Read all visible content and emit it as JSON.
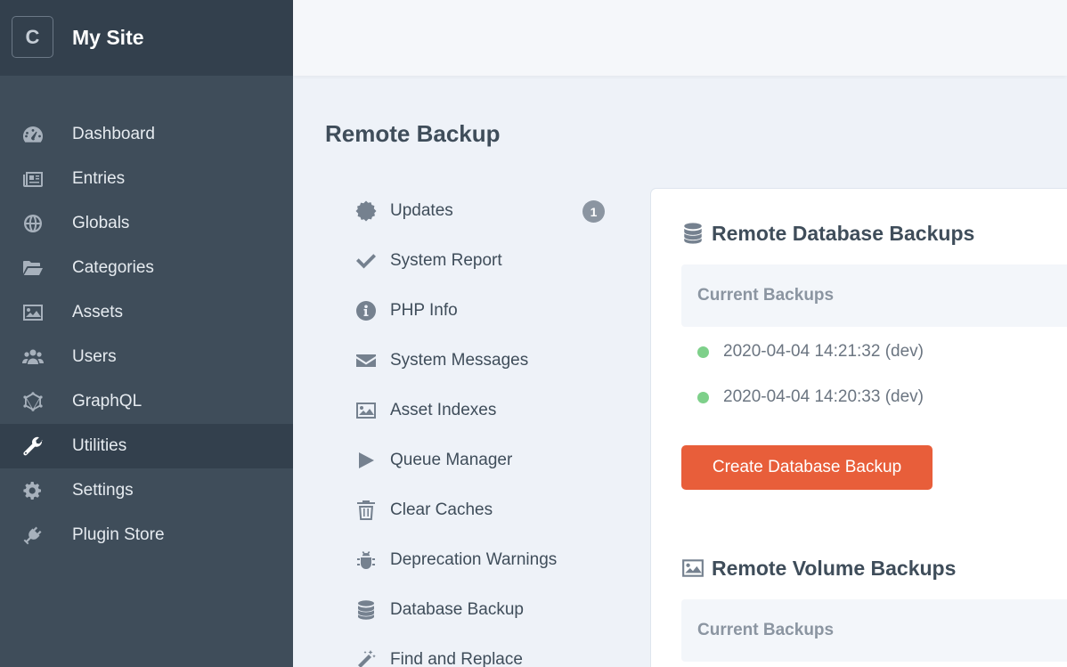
{
  "site": {
    "logo_letter": "C",
    "name": "My Site"
  },
  "sidebar": {
    "items": [
      {
        "label": "Dashboard",
        "icon": "dashboard-gauge-icon"
      },
      {
        "label": "Entries",
        "icon": "newspaper-icon"
      },
      {
        "label": "Globals",
        "icon": "globe-icon"
      },
      {
        "label": "Categories",
        "icon": "folder-open-icon"
      },
      {
        "label": "Assets",
        "icon": "image-icon"
      },
      {
        "label": "Users",
        "icon": "users-icon"
      },
      {
        "label": "GraphQL",
        "icon": "graphql-icon"
      },
      {
        "label": "Utilities",
        "icon": "wrench-icon",
        "active": true
      },
      {
        "label": "Settings",
        "icon": "gear-icon"
      },
      {
        "label": "Plugin Store",
        "icon": "plug-icon"
      }
    ]
  },
  "page": {
    "title": "Remote Backup"
  },
  "utilities": {
    "items": [
      {
        "label": "Updates",
        "icon": "badge-gear-icon",
        "badge": "1"
      },
      {
        "label": "System Report",
        "icon": "checkmark-icon"
      },
      {
        "label": "PHP Info",
        "icon": "info-circle-icon"
      },
      {
        "label": "System Messages",
        "icon": "envelope-icon"
      },
      {
        "label": "Asset Indexes",
        "icon": "image-icon"
      },
      {
        "label": "Queue Manager",
        "icon": "play-icon"
      },
      {
        "label": "Clear Caches",
        "icon": "trash-icon"
      },
      {
        "label": "Deprecation Warnings",
        "icon": "bug-icon"
      },
      {
        "label": "Database Backup",
        "icon": "database-icon"
      },
      {
        "label": "Find and Replace",
        "icon": "magic-wand-icon"
      }
    ]
  },
  "db_backups": {
    "title": "Remote Database Backups",
    "table_header": "Current Backups",
    "rows": [
      "2020-04-04 14:21:32 (dev)",
      "2020-04-04 14:20:33 (dev)"
    ],
    "status_color": "#7ed08a",
    "button_label": "Create Database Backup",
    "button_color": "#e85e3a"
  },
  "volume_backups": {
    "title": "Remote Volume Backups",
    "table_header": "Current Backups"
  }
}
